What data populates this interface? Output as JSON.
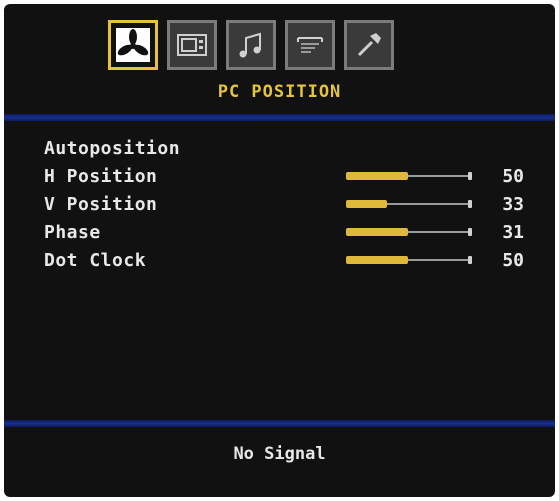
{
  "menu": {
    "title": "PC POSITION",
    "tabs": [
      {
        "icon": "pc-setup-icon",
        "active": true
      },
      {
        "icon": "picture-icon",
        "active": false
      },
      {
        "icon": "sound-icon",
        "active": false
      },
      {
        "icon": "feature-icon",
        "active": false
      },
      {
        "icon": "install-icon",
        "active": false
      }
    ]
  },
  "settings": {
    "autoposition": {
      "label": "Autoposition"
    },
    "h_position": {
      "label": "H Position",
      "value": "50",
      "level": 50
    },
    "v_position": {
      "label": "V Position",
      "value": "33",
      "level": 33
    },
    "phase": {
      "label": "Phase",
      "value": "31",
      "level": 50
    },
    "dot_clock": {
      "label": "Dot Clock",
      "value": "50",
      "level": 50
    }
  },
  "status": {
    "message": "No Signal"
  },
  "colors": {
    "accent": "#e6c43c",
    "divider": "#1a2f8c",
    "background": "#111111",
    "text": "#e8e8e8"
  }
}
